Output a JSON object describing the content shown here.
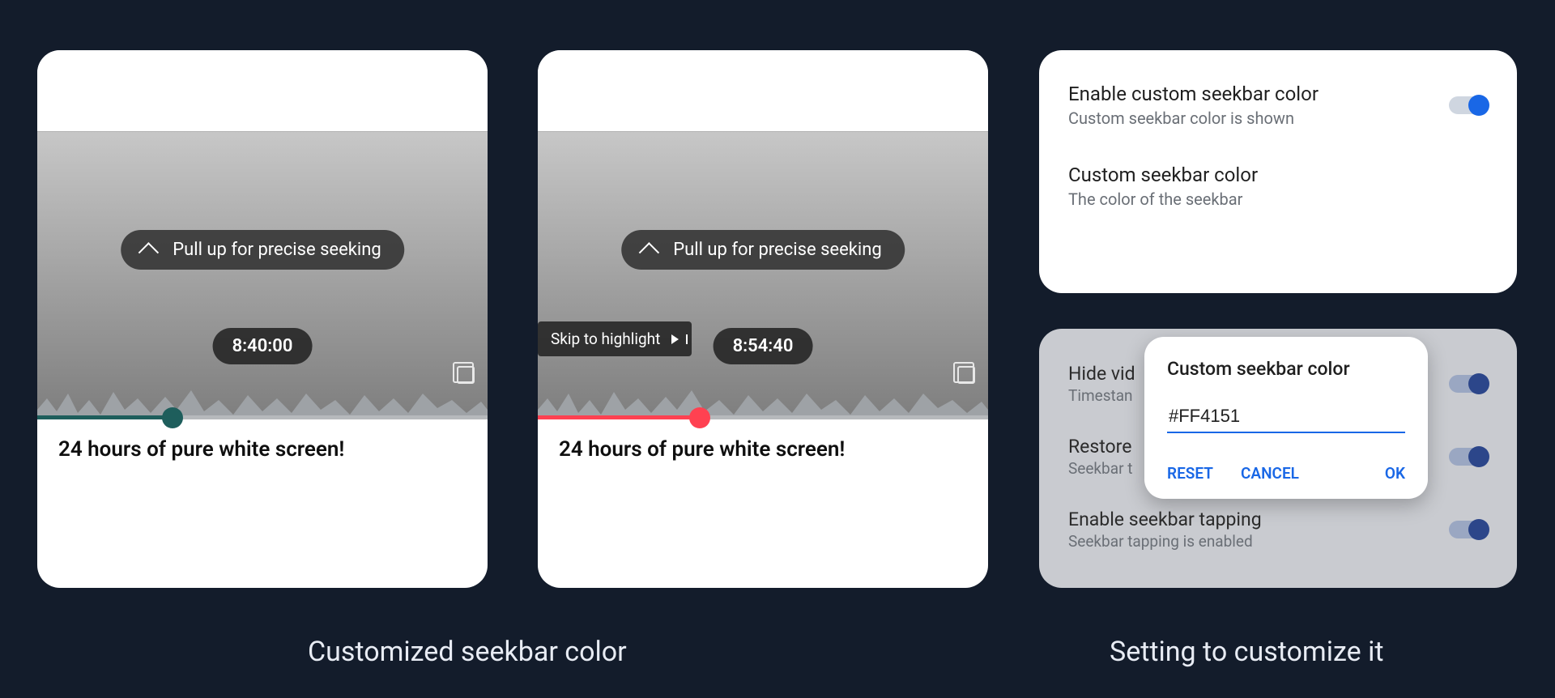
{
  "captions": {
    "left": "Customized seekbar color",
    "right": "Setting to customize it"
  },
  "hint": "Pull up for precise seeking",
  "skip_label": "Skip to highlight",
  "video_title": "24 hours of pure white screen!",
  "cards": [
    {
      "timestamp": "8:40:00",
      "seek_percent": 30,
      "seek_color": "#1e5e5c",
      "show_skip": false
    },
    {
      "timestamp": "8:54:40",
      "seek_percent": 36,
      "seek_color": "#ff4151",
      "show_skip": true
    }
  ],
  "settings": {
    "enable": {
      "title": "Enable custom seekbar color",
      "sub": "Custom seekbar color is shown",
      "on": true
    },
    "color": {
      "title": "Custom seekbar color",
      "sub": "The color of the seekbar"
    },
    "bg_rows": [
      {
        "title": "Hide vid",
        "sub": "Timestan"
      },
      {
        "title": "Restore",
        "sub": "Seekbar t"
      },
      {
        "title": "Enable seekbar tapping",
        "sub": "Seekbar tapping is enabled"
      }
    ]
  },
  "dialog": {
    "title": "Custom seekbar color",
    "value": "#FF4151",
    "reset": "RESET",
    "cancel": "CANCEL",
    "ok": "OK"
  }
}
